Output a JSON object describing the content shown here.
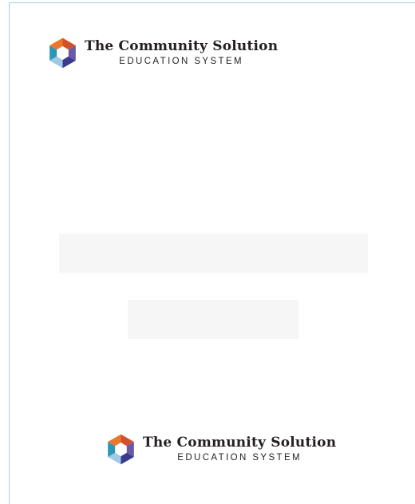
{
  "brand": {
    "name": "The Community Solution",
    "tagline": "EDUCATION SYSTEM",
    "logo_icon": "hexagon-ribbon-icon",
    "colors": {
      "orange": "#e9782b",
      "orange_dark": "#d2512a",
      "purple": "#6a5aa6",
      "indigo": "#3c3a8f",
      "light_blue": "#9ecae6",
      "teal": "#2b97b8"
    }
  }
}
